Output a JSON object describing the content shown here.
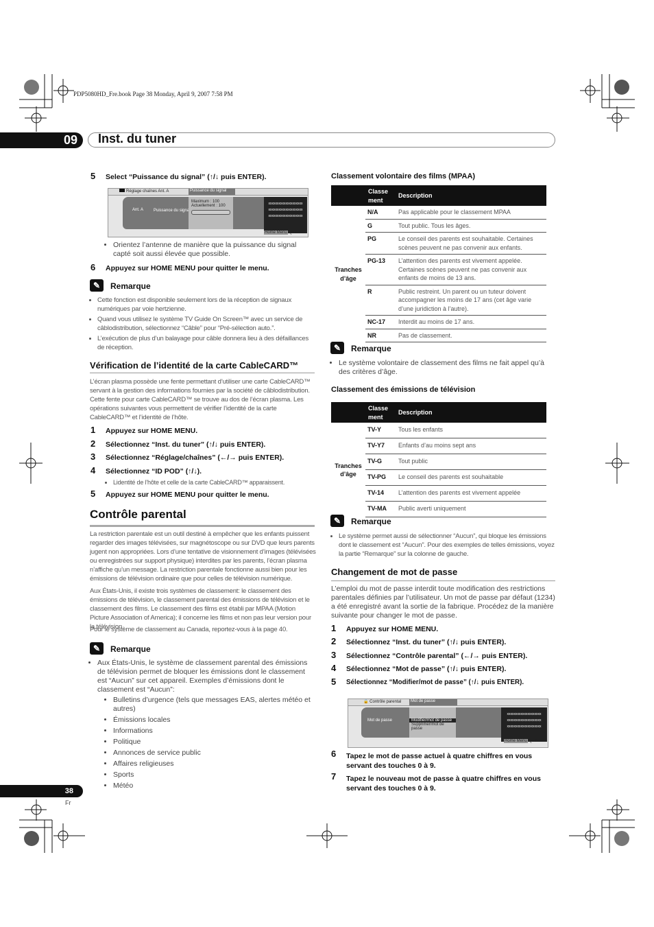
{
  "header": {
    "book_line": "PDP5080HD_Fre.book  Page 38  Monday, April 9, 2007  7:58 PM",
    "chapter_number": "09",
    "chapter_title": "Inst. du tuner"
  },
  "left": {
    "step5": {
      "n": "5",
      "text": "Select “Puissance du signal” (↑/↓ puis ENTER)."
    },
    "screen1": {
      "tab1_icon": "antenna-icon",
      "tab1": "Réglage chaînes",
      "tab1_value": "Ant. A",
      "tab2": "Puissance du signal",
      "label1": "Ant. A",
      "label2": "Puissance du signal",
      "max": "Maximum :   100",
      "current": "Actuellement :   100",
      "info": [
        "xxxxxxxxxxxxxxxxxxxx",
        "xxxxxxxxxxxxxxxxxxxx",
        "xxxxxxxxxxxxxxxxxxxx"
      ],
      "home_menu": "Home Menu",
      "quit": "Quitter",
      "signal_level_pct": 100
    },
    "bullet1": "Orientez l’antenne de manière que la puissance du signal capté soit aussi élevée que possible.",
    "step6": {
      "n": "6",
      "text": "Appuyez sur HOME MENU pour quitter le menu."
    },
    "remarque1": {
      "title": "Remarque",
      "items": [
        "Cette fonction est disponible seulement lors de la réception de signaux numériques par voie hertzienne.",
        "Quand vous utilisez le système TV Guide On Screen™ avec un service de câblodistribution, sélectionnez “Câble” pour “Pré-sélection auto.”.",
        "L’exécution de plus d’un balayage pour câble donnera lieu à des défaillances de réception."
      ]
    },
    "cablecard": {
      "heading": "Vérification de l’identité de la carte CableCARD™",
      "paragraph": "L’écran plasma possède une fente permettant d’utiliser une carte CableCARD™ servant à la gestion des informations fournies par la société de câblodistribution. Cette fente pour carte CableCARD™ se trouve au dos de l’écran plasma. Les opérations suivantes vous permettent de vérifier l’identité de la carte CableCARD™ et l’identité de l’hôte.",
      "steps": [
        {
          "n": "1",
          "text": "Appuyez sur HOME MENU."
        },
        {
          "n": "2",
          "text": "Sélectionnez “Inst. du tuner” (↑/↓ puis ENTER)."
        },
        {
          "n": "3",
          "text": "Sélectionnez “Réglage/chaînes” (←/→ puis ENTER)."
        },
        {
          "n": "4",
          "text": "Sélectionnez “ID POD” (↑/↓)."
        }
      ],
      "sub_bullet": "Lidentité de l’hôte et celle de la carte CableCARD™ apparaissent.",
      "step5": {
        "n": "5",
        "text": "Appuyez sur HOME MENU pour quitter le menu."
      }
    },
    "parental": {
      "heading": "Contrôle parental",
      "p1": "La restriction parentale est un outil destiné à empêcher que les enfants puissent regarder des images télévisées, sur magnétoscope ou sur DVD que leurs parents jugent non appropriées. Lors d’une tentative de visionnement d’images (télévisées ou enregistrées sur support physique) interdites par les parents, l’écran plasma n’affiche qu’un message. La restriction parentale fonctionne aussi bien pour les émissions de télévision ordinaire que pour celles de télévision numérique.",
      "p2": "Aux États-Unis, il existe trois systèmes de classement: le classement des émissions de télévision, le classement parental des émissions de télévision et le classement des films. Le classement des films est établi par MPAA (Motion Picture Association of America); il concerne les films et non pas leur version pour la télévision.",
      "p3": "Pour le système de classement au Canada, reportez-vous à la page 40."
    },
    "remarque2": {
      "title": "Remarque",
      "item": "Aux États-Unis, le système de classement parental des émissions de télévision permet de bloquer les émissions dont le classement est “Aucun” sur cet appareil. Exemples d’émissions dont le classement est “Aucun”:",
      "sub_items": [
        "Bulletins d’urgence (tels que messages EAS, alertes météo et autres)",
        "Émissions locales",
        "Informations",
        "Politique",
        "Annonces de service public",
        "Affaires religieuses",
        "Sports",
        "Météo"
      ]
    }
  },
  "right": {
    "mpaa": {
      "heading": "Classement volontaire des films (MPAA)",
      "col1": "Classe ment",
      "col2": "Description",
      "group_label": "Tranches d’âge",
      "rows": [
        {
          "c": "N/A",
          "d": "Pas applicable pour le classement MPAA"
        },
        {
          "c": "G",
          "d": "Tout public. Tous les âges."
        },
        {
          "c": "PG",
          "d": "Le conseil des parents est souhaitable. Certaines scènes peuvent ne pas convenir aux enfants."
        },
        {
          "c": "PG-13",
          "d": "L’attention des parents est vivement appelée. Certaines scènes peuvent ne pas convenir aux enfants de moins de 13 ans."
        },
        {
          "c": "R",
          "d": "Public restreint. Un parent ou un tuteur doivent accompagner les moins de 17 ans (cet âge varie d’une juridiction à l’autre)."
        },
        {
          "c": "NC-17",
          "d": "Interdit au moins de 17 ans."
        },
        {
          "c": "NR",
          "d": "Pas de classement."
        }
      ]
    },
    "remarque3": {
      "title": "Remarque",
      "item": "Le système volontaire de classement des films ne fait appel qu’à des critères d’âge."
    },
    "tv": {
      "heading": "Classement des émissions de télévision",
      "col1": "Classe ment",
      "col2": "Description",
      "group_label": "Tranches d’âge",
      "rows": [
        {
          "c": "TV-Y",
          "d": "Tous les enfants"
        },
        {
          "c": "TV-Y7",
          "d": "Enfants d’au moins sept ans"
        },
        {
          "c": "TV-G",
          "d": "Tout public"
        },
        {
          "c": "TV-PG",
          "d": "Le conseil des parents est souhaitable"
        },
        {
          "c": "TV-14",
          "d": "L’attention des parents est vivement appelée"
        },
        {
          "c": "TV-MA",
          "d": "Public averti uniquement"
        }
      ]
    },
    "remarque4": {
      "title": "Remarque",
      "item": "Le système permet aussi de sélectionner “Aucun”, qui bloque les émissions dont le classement est “Aucun”. Pour des exemples de telles émissions, voyez la partie “Remarque” sur la colonne de gauche."
    },
    "password": {
      "heading": "Changement de mot de passe",
      "paragraph": "L’emploi du mot de passe interdit toute modification des restrictions parentales définies par l’utilisateur. Un mot de passe par défaut (1234) a été enregistré avant la sortie de la fabrique. Procédez de la manière suivante pour changer le mot de passe.",
      "steps": [
        {
          "n": "1",
          "text": "Appuyez sur HOME MENU."
        },
        {
          "n": "2",
          "text": "Sélectionnez “Inst. du tuner” (↑/↓ puis ENTER)."
        },
        {
          "n": "3",
          "text": "Sélectionnez “Contrôle parental” (←/→ puis ENTER)."
        },
        {
          "n": "4",
          "text": "Sélectionnez “Mot de passe” (↑/↓ puis ENTER)."
        },
        {
          "n": "5",
          "text": "Sélectionnez “Modifier/mot de passe” (↑/↓ puis ENTER)."
        }
      ],
      "screen2": {
        "tab1_icon": "lock-icon",
        "tab1": "Contrôle parental",
        "tab2": "Mot de passe",
        "label": "Mot de passe",
        "options": [
          "Modifier/mot de passe",
          "Supprimer/mot de passe"
        ],
        "info": [
          "xxxxxxxxxxxxxxxxxxxx",
          "xxxxxxxxxxxxxxxxxxxx",
          "xxxxxxxxxxxxxxxxxxxx"
        ],
        "home_menu": "Home Menu",
        "quit": "Quitter"
      },
      "step6": {
        "n": "6",
        "text": "Tapez le mot de passe actuel à quatre chiffres en vous servant des touches 0 à 9."
      },
      "step7": {
        "n": "7",
        "text": "Tapez le nouveau mot de passe à quatre chiffres en vous servant des touches 0 à 9."
      }
    }
  },
  "footer": {
    "page_number": "38",
    "lang": "Fr"
  }
}
